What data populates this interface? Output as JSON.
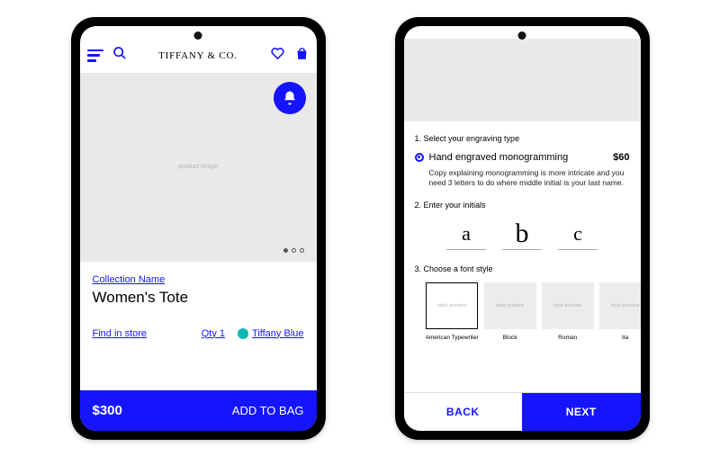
{
  "colors": {
    "accent": "#1414ff",
    "tiffany": "#0abab5"
  },
  "left": {
    "brand": "TIFFANY & CO.",
    "productImagePlaceholder": "product image",
    "collectionLink": "Collection Name",
    "productTitle": "Women's Tote",
    "findInStore": "Find in store",
    "qtyLabel": "Qty 1",
    "swatchLabel": "Tiffany Blue",
    "price": "$300",
    "addToBag": "ADD TO BAG"
  },
  "right": {
    "step1Label": "1. Select your engraving type",
    "optionLabel": "Hand engraved monogramming",
    "optionPrice": "$60",
    "optionCopy": "Copy explaining monogramming is more intricate and you need 3 letters to do where middle initial is your last name.",
    "step2Label": "2. Enter your initials",
    "initials": {
      "a": "a",
      "b": "b",
      "c": "c"
    },
    "step3Label": "3. Choose a font style",
    "previewText": "style preview",
    "fonts": [
      "American Typewriter",
      "Block",
      "Roman",
      "Ita"
    ],
    "back": "BACK",
    "next": "NEXT"
  }
}
